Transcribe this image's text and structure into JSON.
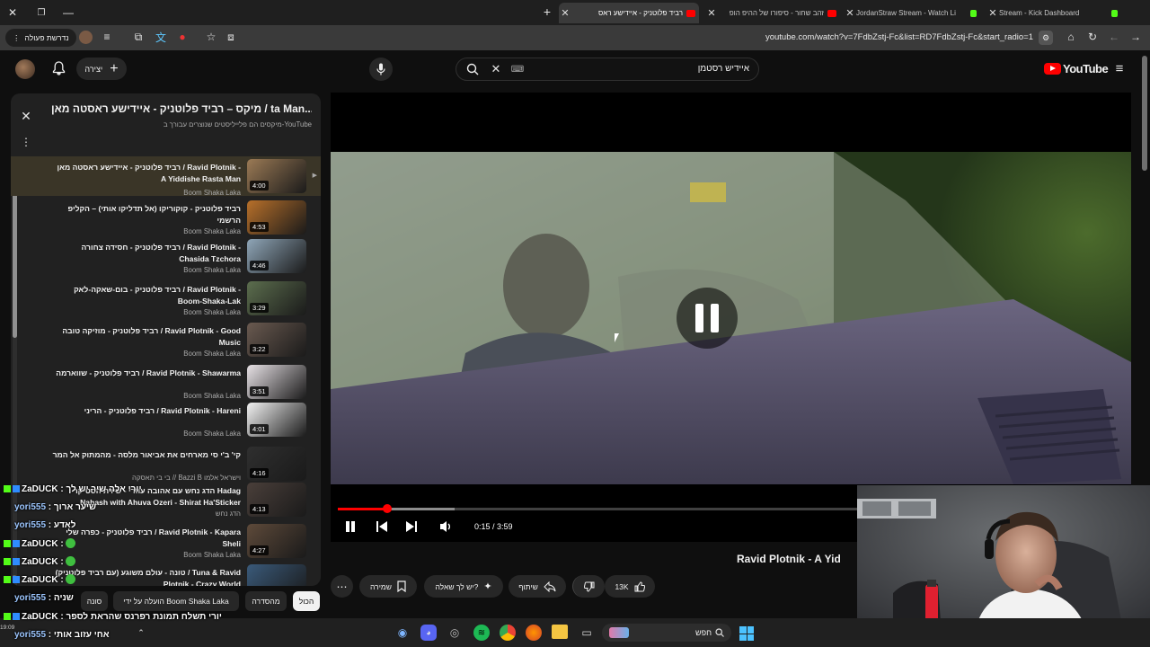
{
  "browser": {
    "tabs": [
      {
        "title": "רביד פלוטניק - איידישע ראס",
        "active": true
      },
      {
        "title": "זהב שחור - סיפורו של ההיפ הופ"
      },
      {
        "title": "JordanStraw Stream - Watch Li"
      },
      {
        "title": "Stream - Kick Dashboard"
      }
    ],
    "url": "youtube.com/watch?v=7FdbZstj-Fc&list=RD7FdbZstj-Fc&start_radio=1",
    "action_label": "נדרשת פעולה"
  },
  "youtube": {
    "logo_text": "YouTube",
    "search_value": "איידיש רסטמן",
    "create_label": "יצירה"
  },
  "playlist": {
    "title": "מיקס – רביד פלוטניק - איידישע ראסטה מאן / Ravid Plotnik - A Yiddishe Rasta Man",
    "title_display": "מיקס – רביד פלוטניק - איידישע ראסטה מאן / ta Man...",
    "subtitle": "מיקסים הם פלייליסטים שנוצרים עבורך ב-YouTube",
    "items": [
      {
        "title": "רביד פלוטניק - איידישע ראסטה מאן / Ravid Plotnik - A Yiddishe Rasta Man",
        "channel": "Boom Shaka Laka",
        "duration": "4:00",
        "current": true
      },
      {
        "title": "רביד פלוטניק - קוקוריקו (אל תדליקו אותי) – הקליפ הרשמי",
        "channel": "Boom Shaka Laka",
        "duration": "4:53"
      },
      {
        "title": "רביד פלוטניק - חסידה צחורה / Ravid Plotnik - Chasida Tzchora",
        "channel": "Boom Shaka Laka",
        "duration": "4:46"
      },
      {
        "title": "רביד פלוטניק - בום-שאקה-לאק / Ravid Plotnik - Boom-Shaka-Lak",
        "channel": "Boom Shaka Laka",
        "duration": "3:29"
      },
      {
        "title": "רביד פלוטניק - מוזיקה טובה / Ravid Plotnik - Good Music",
        "channel": "Boom Shaka Laka",
        "duration": "3:22"
      },
      {
        "title": "רביד פלוטניק - שווארמה / Ravid Plotnik - Shawarma",
        "channel": "Boom Shaka Laka",
        "duration": "3:51"
      },
      {
        "title": "רביד פלוטניק - הריני / Ravid Plotnik - Hareni",
        "channel": "Boom Shaka Laka",
        "duration": "4:01"
      },
      {
        "title": "קי' ב'י סי מארחים את אביאור מלסה - מהמתוק אל המר",
        "channel": "בי בי תאסקה // Bazzi B וישראל אלמו",
        "duration": "4:16"
      },
      {
        "title": "הדג נחש עם אהובה עוזרי - שירת הסטיקר Hadag Nahash with Ahuva Ozeri - Shirat Ha'Sticker",
        "channel": "הדג נחש",
        "duration": "4:13"
      },
      {
        "title": "רביד פלוטניק - כפרה שלי / Ravid Plotnik - Kapara Sheli",
        "channel": "Boom Shaka Laka",
        "duration": "4:27"
      },
      {
        "title": "טונה - עולם משוגע (עם רביד פלוטניק) / Tuna & Ravid Plotnik - Crazy World",
        "channel": "",
        "duration": ""
      }
    ]
  },
  "player": {
    "time": "0:15 / 3:59",
    "progress": 0.063
  },
  "video_info": {
    "title": "Ravid Plotnik - A Yid",
    "likes": "13K",
    "share_label": "שיתוף",
    "ask_label": "יש לך שאלה?",
    "save_label": "שמירה"
  },
  "chips": [
    "הכול",
    "מהסדרה",
    "הועלה על ידי Boom Shaka Laka",
    "סונה"
  ],
  "chat": [
    {
      "user": "ZaDUCK",
      "text": "יורי אלה שיר יש לך"
    },
    {
      "user": "yori555",
      "text": "שיער ארוך",
      "blue": true
    },
    {
      "user": "yori555",
      "text": "לאדע",
      "blue": true
    },
    {
      "user": "ZaDUCK",
      "text": ""
    },
    {
      "user": "ZaDUCK",
      "text": ""
    },
    {
      "user": "ZaDUCK",
      "text": ""
    },
    {
      "user": "yori555",
      "text": "שניה",
      "blue": true
    },
    {
      "user": "ZaDUCK",
      "text": "יורי תשלח תמונת רפרנס שהראת לספר"
    },
    {
      "user": "yori555",
      "text": "אחי עזוב אותי",
      "blue": true
    }
  ],
  "taskbar": {
    "search_placeholder": "חפש",
    "time": "19:09"
  },
  "colors": {
    "yt_red": "#ff0000",
    "bg": "#0f0f0f",
    "panel": "#212121",
    "kick_green": "#53fc18"
  }
}
